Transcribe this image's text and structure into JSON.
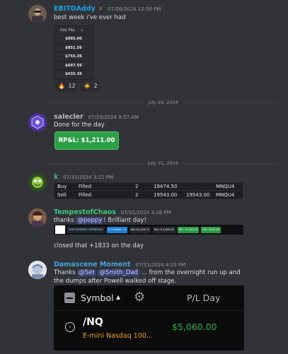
{
  "messages": [
    {
      "username": "EBITDAddy",
      "badge_icon": "lightning-icon",
      "timestamp": "07/26/2024 12:50 PM",
      "text": "best week i've ever had",
      "table_header": "Day P&L",
      "table_values": [
        "$885.00",
        "$851.56",
        "$755.36",
        "$697.56",
        "$635.36"
      ],
      "reactions": [
        {
          "emoji": "🔥",
          "count": "12"
        },
        {
          "emoji": "🧔",
          "count": "2"
        }
      ]
    },
    {
      "username": "salecler",
      "timestamp": "07/29/2024 9:57 AM",
      "text": "Done for the day",
      "rpl": "RP&L: $1,211.00"
    },
    {
      "username": "k",
      "timestamp": "07/31/2024 3:22 PM",
      "orders": [
        [
          "Buy",
          "Filled",
          "2",
          "19474.50",
          "",
          "MNQU4"
        ],
        [
          "Sell",
          "Filled",
          "2",
          "19543.00",
          "19543.00",
          "MNQU4"
        ]
      ]
    },
    {
      "username": "TempestofChaos",
      "timestamp": "07/31/2024 3:28 PM",
      "text_pre": "thanks",
      "mention": "@poppy",
      "text_post": "! Brilliant day!",
      "toolbar_chips": [
        "DOM EXPRESS | EXPRESSEL",
        "A • Leader • 3",
        "Bal: $1,318.75",
        "MLL: $ 3,000.00",
        "RPL: $1,548.35",
        "UPL: $932.56"
      ],
      "caption": "closed that +1833 on the day"
    },
    {
      "username": "Damascene Moment",
      "timestamp": "07/31/2024 4:03 PM",
      "text_pre": "Thanks",
      "mention1": "@Set",
      "mention2": "@Smith_Dad",
      "text_post": "... from the overnight run up and",
      "text_line2": "the dumps after Powell walked off stage.",
      "card": {
        "col_symbol": "Symbol",
        "col_pl": "P/L Day",
        "symbol": "/NQ",
        "description": "E-mini Nasdaq 100...",
        "pl_value": "$5,060.00"
      }
    }
  ],
  "dividers": [
    "July 29, 2024",
    "July 31, 2024"
  ],
  "colors": {
    "bg": "#313338",
    "ebitdaddy": "#1aa1e0",
    "salecler": "#949ba4",
    "k": "#43b581",
    "tempest": "#3fc77d",
    "damascene": "#4aa3d8",
    "profit": "#2fb24c"
  }
}
